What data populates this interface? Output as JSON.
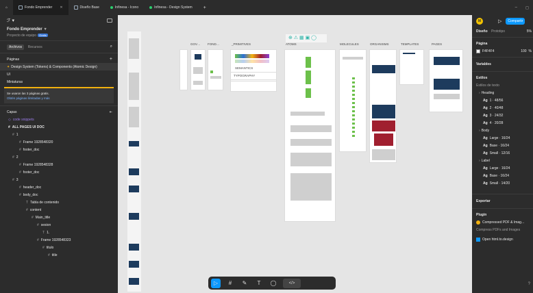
{
  "tabs": {
    "home": "⌂",
    "tab1": "Fondo Emprender",
    "tab1_close": "✕",
    "tab2": "Diseño Base",
    "tab3": "Infinesa - Icono",
    "tab4": "Infinesa - Design System",
    "add": "+"
  },
  "window": {
    "minimize": "–",
    "restore": "◻"
  },
  "left": {
    "logo": "ℱ ▾",
    "file_title": "Fondo Emprender",
    "project": "Proyecto de equipo",
    "badge": "Gratis",
    "tab_files": "Archivos",
    "tab_assets": "Recursos",
    "pages_title": "Páginas",
    "pages": [
      "Design System (Tokens) & Components (Atomic Design)",
      "UI",
      "Miniaturas"
    ],
    "notice": "Se usaron las 3 páginas gratis.",
    "notice_link": "Obtén páginas ilimitadas y más",
    "layers_title": "Capas",
    "layers": [
      "code snippets",
      "ALL PAGES UI DOC",
      "1",
      "Frame 1928548320",
      "footer_doc",
      "2",
      "Frame 1928548328",
      "footer_doc",
      "3",
      "header_doc",
      "body_doc",
      "Tabla de contenido",
      "content",
      "Main_title",
      "sesion",
      "1.",
      "Frame 1928548323",
      "titulo",
      "title"
    ]
  },
  "canvas": {
    "frames": [
      "GOV…",
      "FOND…",
      "_PRIMITIVES",
      "ATOMS",
      "MOLECULES",
      "ORGANISMS",
      "TEMPLATES",
      "PAGES"
    ],
    "semantics": "SEMANTICS",
    "typography": "TYPOGRAPHY"
  },
  "toolbar": {
    "move": "▷",
    "frame": "#",
    "pen": "✎",
    "text": "T",
    "comment": "◯",
    "dev": "</>"
  },
  "right": {
    "avatar": "M",
    "play": "▷",
    "share": "Compartir",
    "tab_design": "Diseño",
    "tab_proto": "Prototipo",
    "zoom": "5%",
    "page_section": "Página",
    "page_color": "F4F4F4",
    "page_opacity": "100",
    "page_unit": "%",
    "variables": "Variables",
    "styles": "Estilos",
    "text_styles": "Estilos de texto",
    "heading_group": "Heading",
    "body_group": "Body",
    "label_group": "Label",
    "heading_styles": [
      "1 · 48/56",
      "2 · 40/48",
      "3 · 24/32",
      "4 · 20/28"
    ],
    "body_styles": [
      "Large · 16/24",
      "Base · 16/24",
      "Small · 12/16"
    ],
    "label_styles": [
      "Large · 16/24",
      "Base · 16/24",
      "Small · 14/20"
    ],
    "ag": "Ag",
    "export": "Exportar",
    "plugin": "Plugin",
    "plugin1": "Compressed PDF & Imag...",
    "plugin1_desc": "Compress PDFs and Images",
    "plugin2": "Open html.to.design",
    "help": "?"
  }
}
